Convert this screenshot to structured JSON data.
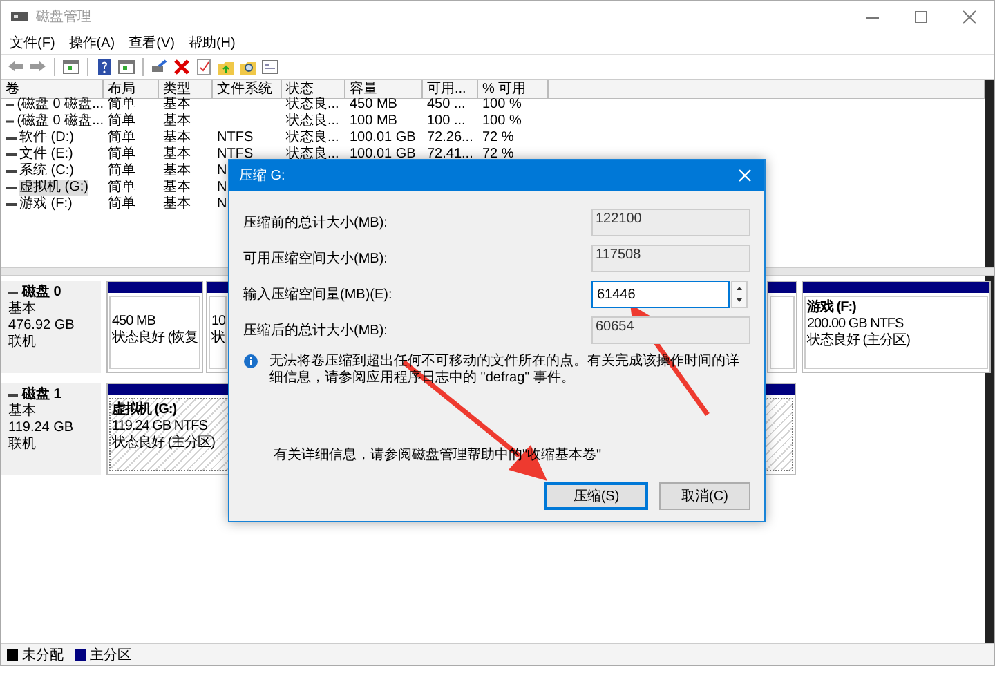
{
  "window": {
    "title": "磁盘管理"
  },
  "menu": [
    "文件(F)",
    "操作(A)",
    "查看(V)",
    "帮助(H)"
  ],
  "volume_table": {
    "columns": [
      "卷",
      "布局",
      "类型",
      "文件系统",
      "状态",
      "容量",
      "可用...",
      "% 可用"
    ],
    "rows": [
      {
        "volume": "(磁盘 0 磁盘...",
        "layout": "简单",
        "type": "基本",
        "status": "状态良...",
        "capacity": "450 MB",
        "free": "450 ...",
        "percent_free": "100 %",
        "selected": false
      },
      {
        "volume": "(磁盘 0 磁盘...",
        "layout": "简单",
        "type": "基本",
        "status": "状态良...",
        "capacity": "100 MB",
        "free": "100 ...",
        "percent_free": "100 %",
        "selected": false
      },
      {
        "volume": "软件 (D:)",
        "layout": "简单",
        "type": "基本",
        "file_system": "NTFS",
        "status": "状态良...",
        "capacity": "100.01 GB",
        "free": "72.26...",
        "percent_free": "72 %",
        "selected": false
      },
      {
        "volume": "文件 (E:)",
        "layout": "简单",
        "type": "基本",
        "file_system": "NTFS",
        "status": "状态良...",
        "capacity": "100.01 GB",
        "free": "72.41...",
        "percent_free": "72 %",
        "selected": false
      },
      {
        "volume": "系统 (C:)",
        "layout": "简单",
        "type": "基本",
        "file_system": "N",
        "selected": false
      },
      {
        "volume": "虚拟机 (G:)",
        "layout": "简单",
        "type": "基本",
        "file_system": "N",
        "selected": true
      },
      {
        "volume": "游戏 (F:)",
        "layout": "简单",
        "type": "基本",
        "file_system": "N",
        "selected": false
      }
    ]
  },
  "disks": [
    {
      "name": "磁盘 0",
      "type": "基本",
      "size": "476.92 GB",
      "status": "联机",
      "partitions": [
        {
          "lines": [
            "450 MB",
            "状态良好 (恢复"
          ],
          "selected": false
        },
        {
          "lines": [
            "10",
            "状"
          ],
          "selected": false
        },
        {
          "selected": false
        },
        {
          "name": "游戏  (F:)",
          "lines": [
            "200.00 GB NTFS",
            "状态良好 (主分区)"
          ],
          "selected": false
        }
      ]
    },
    {
      "name": "磁盘 1",
      "type": "基本",
      "size": "119.24 GB",
      "status": "联机",
      "partitions": [
        {
          "name": "虚拟机  (G:)",
          "lines": [
            "119.24 GB NTFS",
            "状态良好 (主分区)"
          ],
          "selected": true
        }
      ]
    }
  ],
  "legend": [
    {
      "label": "未分配",
      "color": "#000000"
    },
    {
      "label": "主分区",
      "color": "#00007f"
    }
  ],
  "dialog": {
    "title": "压缩 G:",
    "fields": [
      {
        "label": "压缩前的总计大小(MB):",
        "value": "122100",
        "kind": "readonly"
      },
      {
        "label": "可用压缩空间大小(MB):",
        "value": "117508",
        "kind": "readonly"
      },
      {
        "label": "输入压缩空间量(MB)(E):",
        "value": "61446",
        "kind": "spin"
      },
      {
        "label": "压缩后的总计大小(MB):",
        "value": "60654",
        "kind": "readonly"
      }
    ],
    "info": "无法将卷压缩到超出任何不可移动的文件所在的点。有关完成该操作时间的详细信息，请参阅应用程序日志中的 \"defrag\" 事件。",
    "help": "有关详细信息，请参阅磁盘管理帮助中的\"收缩基本卷\"",
    "buttons": [
      {
        "label": "压缩(S)",
        "default": true
      },
      {
        "label": "取消(C)",
        "default": false
      }
    ]
  }
}
